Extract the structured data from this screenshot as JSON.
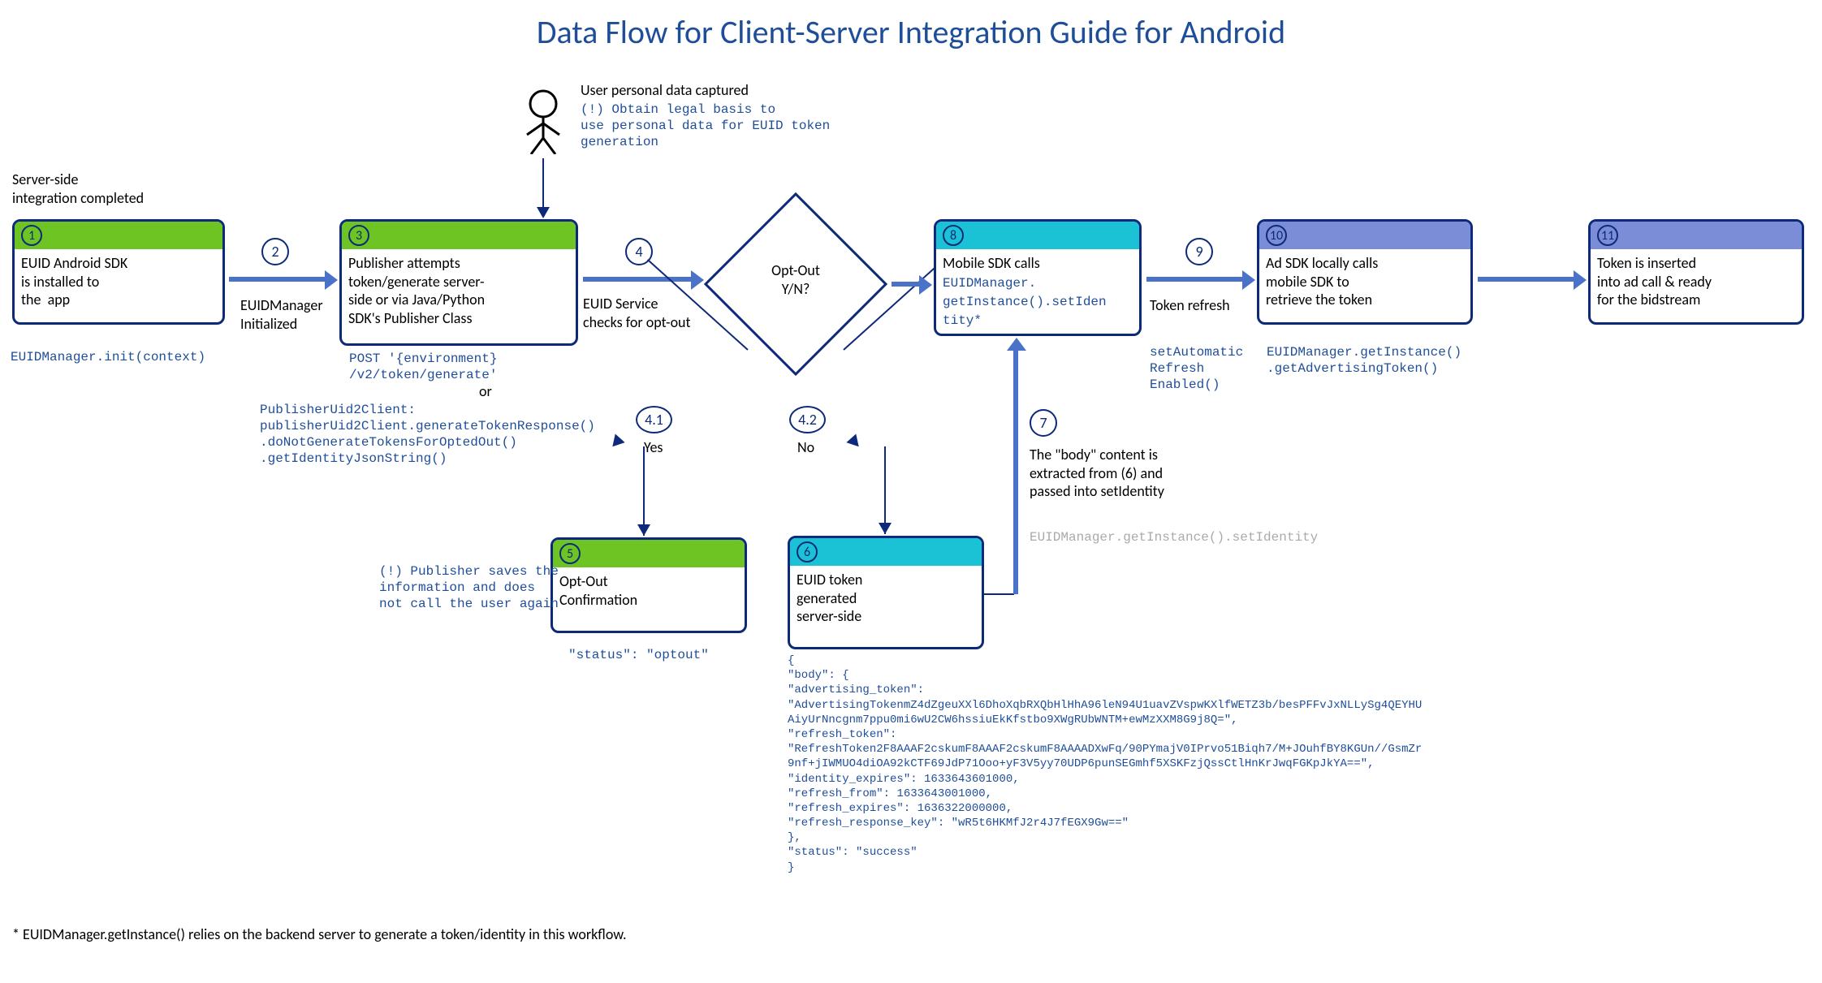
{
  "title": "Data Flow for Client-Server Integration Guide for Android",
  "labels": {
    "server_side": "Server-side\nintegration completed",
    "user_data": "User personal data captured",
    "user_data_note": "(!) Obtain legal basis to\nuse personal data for EUID token\ngeneration",
    "step2": "EUIDManager\nInitialized",
    "step4": "EUID Service\nchecks for opt-out",
    "step7": "The \"body\" content is\nextracted from (6) and\npassed into setIdentity",
    "step9": "Token refresh",
    "step41": "Yes",
    "step42": "No"
  },
  "steps": {
    "s1": "1",
    "s2": "2",
    "s3": "3",
    "s4": "4",
    "s41": "4.1",
    "s42": "4.2",
    "s5": "5",
    "s6": "6",
    "s7": "7",
    "s8": "8",
    "s9": "9",
    "s10": "10",
    "s11": "11"
  },
  "nodes": {
    "n1": "EUID Android SDK\nis installed to\nthe  app",
    "n3": "Publisher attempts\ntoken/generate server-\nside or via Java/Python\nSDK's Publisher Class",
    "n5": "Opt-Out\nConfirmation",
    "n6": "EUID token\ngenerated\nserver-side",
    "n8": "Mobile SDK calls",
    "n10": "Ad SDK locally calls\nmobile SDK to\nretrieve the token",
    "n11": "Token is inserted\ninto ad call & ready\nfor the bidstream"
  },
  "diamond": "Opt-Out\nY/N?",
  "codes": {
    "c2": "EUIDManager.init(context)",
    "c3a": "POST '{environment}\n/v2/token/generate'",
    "c3or": "or",
    "c3b": "PublisherUid2Client:\npublisherUid2Client.generateTokenResponse()\n.doNotGenerateTokensForOptedOut()\n.getIdentityJsonString()",
    "c5note": "(!) Publisher saves the\ninformation and does\nnot call the user again",
    "c5": "\"status\": \"optout\"",
    "c7": "EUIDManager.getInstance().setIdentity",
    "c8": "EUIDManager.\ngetInstance().setIden\ntity*",
    "c9": "setAutomatic\nRefresh\nEnabled()",
    "c10": "EUIDManager.getInstance()\n.getAdvertisingToken()"
  },
  "json_dump": "{\n\"body\": {\n\"advertising_token\":\n\"AdvertisingTokenmZ4dZgeuXXl6DhoXqbRXQbHlHhA96leN94U1uavZVspwKXlfWETZ3b/besPFFvJxNLLySg4QEYHU\nAiyUrNncgnm7ppu0mi6wU2CW6hssiuEkKfstbo9XWgRUbWNTM+ewMzXXM8G9j8Q=\",\n\"refresh_token\":\n\"RefreshToken2F8AAAF2cskumF8AAAF2cskumF8AAAADXwFq/90PYmajV0IPrvo51Biqh7/M+JOuhfBY8KGUn//GsmZr\n9nf+jIWMUO4diOA92kCTF69JdP71Ooo+yF3V5yy70UDP6punSEGmhf5XSKFzjQssCtlHnKrJwqFGKpJkYA==\",\n\"identity_expires\": 1633643601000,\n\"refresh_from\": 1633643001000,\n\"refresh_expires\": 1636322000000,\n\"refresh_response_key\": \"wR5t6HKMfJ2r4J7fEGX9Gw==\"\n},\n\"status\": \"success\"\n}",
  "footnote": "* EUIDManager.getInstance() relies on the backend server to generate a token/identity in this workflow."
}
